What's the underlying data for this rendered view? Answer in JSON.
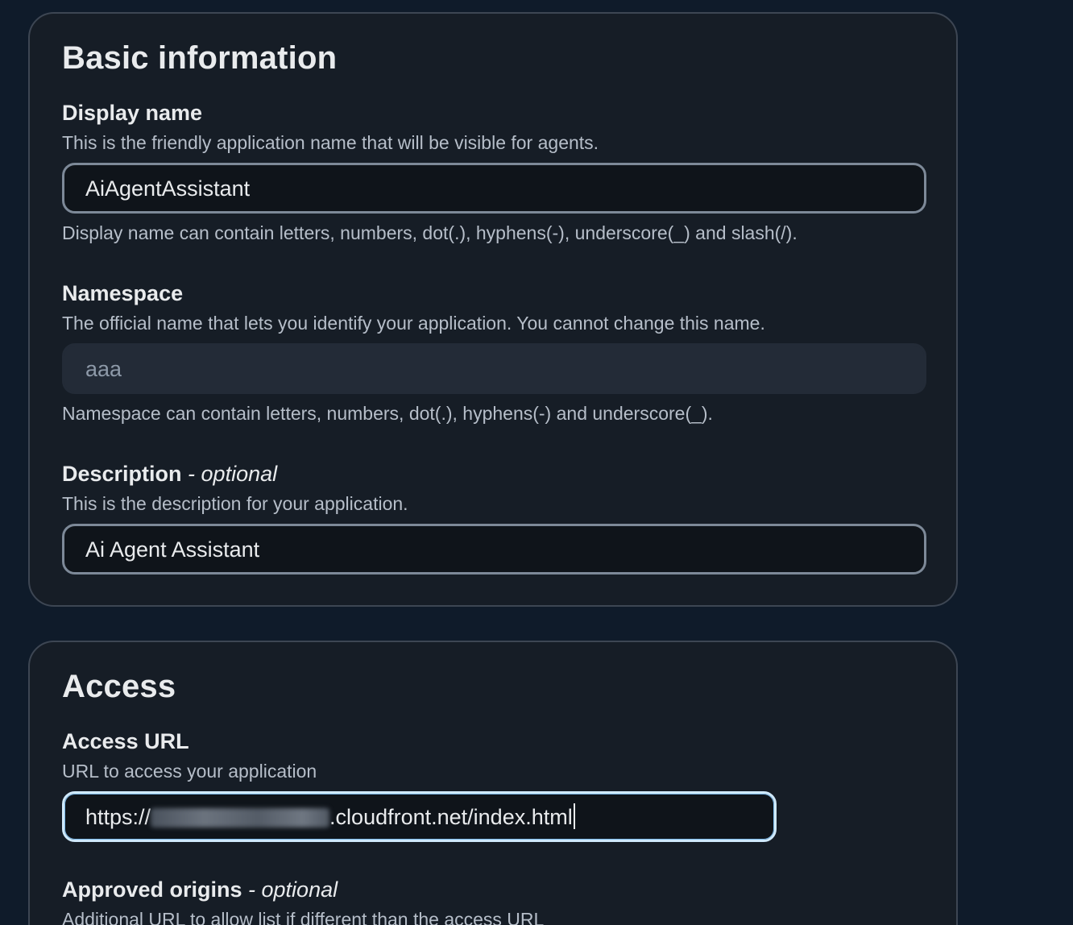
{
  "basic": {
    "title": "Basic information",
    "display_name": {
      "label": "Display name",
      "description": "This is the friendly application name that will be visible for agents.",
      "value": "AiAgentAssistant",
      "constraint": "Display name can contain letters, numbers, dot(.), hyphens(-), underscore(_) and slash(/)."
    },
    "namespace": {
      "label": "Namespace",
      "description": "The official name that lets you identify your application. You cannot change this name.",
      "value": "aaa",
      "constraint": "Namespace can contain letters, numbers, dot(.), hyphens(-) and underscore(_)."
    },
    "description_field": {
      "label": "Description",
      "optional": "- optional",
      "description": "This is the description for your application.",
      "value": "Ai Agent Assistant"
    }
  },
  "access": {
    "title": "Access",
    "access_url": {
      "label": "Access URL",
      "description": "URL to access your application",
      "value_prefix": "https://",
      "value_suffix": ".cloudfront.net/index.html"
    },
    "approved_origins": {
      "label": "Approved origins",
      "optional": "- optional",
      "description": "Additional URL to allow list if different than the access URL"
    }
  },
  "colors": {
    "background": "#0f1b2a",
    "card": "#161d26",
    "focus_border": "#cfe9fb"
  }
}
